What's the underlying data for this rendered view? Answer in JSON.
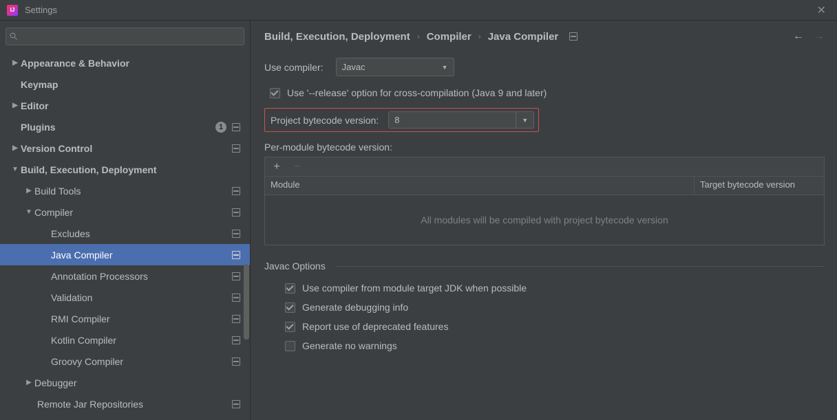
{
  "title": "Settings",
  "search_placeholder": "",
  "tree": {
    "appearance": "Appearance & Behavior",
    "keymap": "Keymap",
    "editor": "Editor",
    "plugins": "Plugins",
    "plugins_count": "1",
    "version_control": "Version Control",
    "build": "Build, Execution, Deployment",
    "build_tools": "Build Tools",
    "compiler": "Compiler",
    "excludes": "Excludes",
    "java_compiler": "Java Compiler",
    "annotation": "Annotation Processors",
    "validation": "Validation",
    "rmi": "RMI Compiler",
    "kotlin": "Kotlin Compiler",
    "groovy": "Groovy Compiler",
    "debugger": "Debugger",
    "remote_jar": "Remote Jar Repositories"
  },
  "breadcrumb": {
    "a": "Build, Execution, Deployment",
    "b": "Compiler",
    "c": "Java Compiler"
  },
  "labels": {
    "use_compiler": "Use compiler:",
    "use_release": "Use '--release' option for cross-compilation (Java 9 and later)",
    "project_bytecode": "Project bytecode version:",
    "per_module": "Per-module bytecode version:",
    "module_col": "Module",
    "target_col": "Target bytecode version",
    "empty_modules": "All modules will be compiled with project bytecode version",
    "javac_options": "Javac Options",
    "opt_jdk": "Use compiler from module target JDK when possible",
    "opt_debug": "Generate debugging info",
    "opt_deprecated": "Report use of deprecated features",
    "opt_nowarn": "Generate no warnings"
  },
  "values": {
    "compiler_select": "Javac",
    "bytecode_version": "8"
  }
}
